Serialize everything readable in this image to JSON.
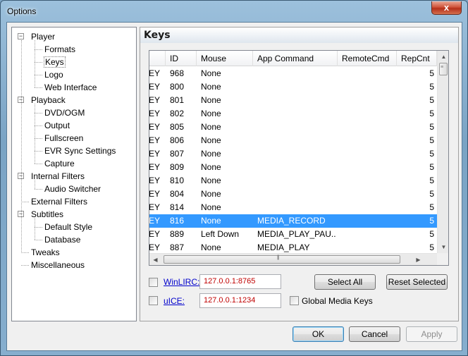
{
  "window": {
    "title": "Options",
    "close_glyph": "x"
  },
  "tree": {
    "items": [
      {
        "label": "Player",
        "level": 0,
        "expanded": true
      },
      {
        "label": "Formats",
        "level": 1
      },
      {
        "label": "Keys",
        "level": 1,
        "selected": true
      },
      {
        "label": "Logo",
        "level": 1
      },
      {
        "label": "Web Interface",
        "level": 1
      },
      {
        "label": "Playback",
        "level": 0,
        "expanded": true
      },
      {
        "label": "DVD/OGM",
        "level": 1
      },
      {
        "label": "Output",
        "level": 1
      },
      {
        "label": "Fullscreen",
        "level": 1
      },
      {
        "label": "EVR Sync Settings",
        "level": 1
      },
      {
        "label": "Capture",
        "level": 1
      },
      {
        "label": "Internal Filters",
        "level": 0,
        "expanded": true
      },
      {
        "label": "Audio Switcher",
        "level": 1
      },
      {
        "label": "External Filters",
        "level": 0
      },
      {
        "label": "Subtitles",
        "level": 0,
        "expanded": true
      },
      {
        "label": "Default Style",
        "level": 1
      },
      {
        "label": "Database",
        "level": 1
      },
      {
        "label": "Tweaks",
        "level": 0
      },
      {
        "label": "Miscellaneous",
        "level": 0
      }
    ]
  },
  "panel": {
    "title": "Keys"
  },
  "keys_table": {
    "columns": [
      "",
      "ID",
      "Mouse",
      "App Command",
      "RemoteCmd",
      "RepCnt"
    ],
    "rows": [
      {
        "key": "KEY",
        "id": "968",
        "mouse": "None",
        "app": "",
        "remote": "",
        "rep": "5"
      },
      {
        "key": "KEY",
        "id": "800",
        "mouse": "None",
        "app": "",
        "remote": "",
        "rep": "5"
      },
      {
        "key": "KEY",
        "id": "801",
        "mouse": "None",
        "app": "",
        "remote": "",
        "rep": "5"
      },
      {
        "key": "KEY",
        "id": "802",
        "mouse": "None",
        "app": "",
        "remote": "",
        "rep": "5"
      },
      {
        "key": "KEY",
        "id": "805",
        "mouse": "None",
        "app": "",
        "remote": "",
        "rep": "5"
      },
      {
        "key": "KEY",
        "id": "806",
        "mouse": "None",
        "app": "",
        "remote": "",
        "rep": "5"
      },
      {
        "key": "KEY",
        "id": "807",
        "mouse": "None",
        "app": "",
        "remote": "",
        "rep": "5"
      },
      {
        "key": "KEY",
        "id": "809",
        "mouse": "None",
        "app": "",
        "remote": "",
        "rep": "5"
      },
      {
        "key": "KEY",
        "id": "810",
        "mouse": "None",
        "app": "",
        "remote": "",
        "rep": "5"
      },
      {
        "key": "KEY",
        "id": "804",
        "mouse": "None",
        "app": "",
        "remote": "",
        "rep": "5"
      },
      {
        "key": "KEY",
        "id": "814",
        "mouse": "None",
        "app": "",
        "remote": "",
        "rep": "5"
      },
      {
        "key": "KEY",
        "id": "816",
        "mouse": "None",
        "app": "MEDIA_RECORD",
        "remote": "",
        "rep": "5",
        "selected": true
      },
      {
        "key": "KEY",
        "id": "889",
        "mouse": "Left Down",
        "app": "MEDIA_PLAY_PAU...",
        "remote": "",
        "rep": "5"
      },
      {
        "key": "KEY",
        "id": "887",
        "mouse": "None",
        "app": "MEDIA_PLAY",
        "remote": "",
        "rep": "5"
      }
    ]
  },
  "winlirc": {
    "label": "WinLIRC:",
    "value": "127.0.0.1:8765",
    "checked": false
  },
  "uice": {
    "label": "uICE:",
    "value": "127.0.0.1:1234",
    "checked": false
  },
  "global_media_keys": {
    "label": "Global Media Keys",
    "checked": false
  },
  "buttons": {
    "select_all": "Select All",
    "reset_selected": "Reset Selected",
    "ok": "OK",
    "cancel": "Cancel",
    "apply": "Apply"
  },
  "colors": {
    "selection": "#3399ff",
    "ip_text": "#c00000",
    "link": "#0000cc"
  }
}
